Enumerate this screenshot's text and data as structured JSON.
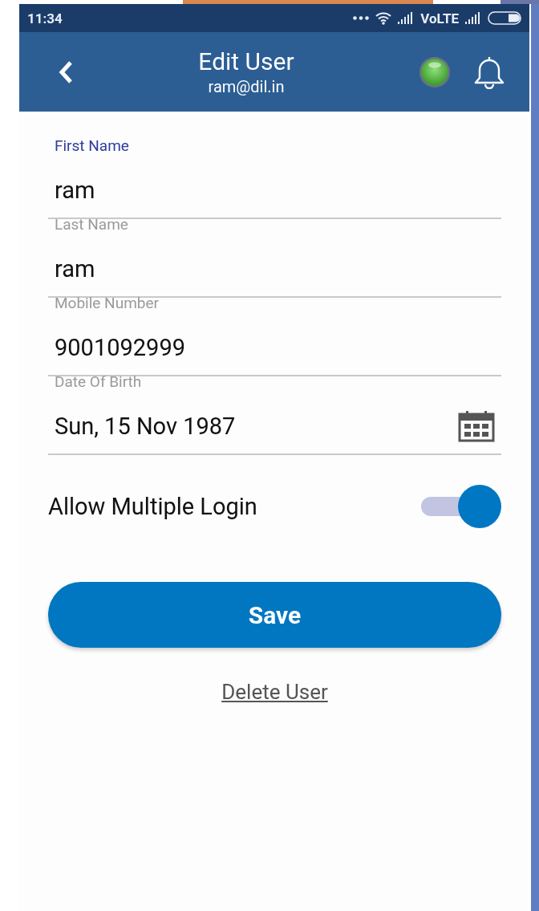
{
  "status_bar": {
    "time": "11:34",
    "network": "VoLTE"
  },
  "header": {
    "title": "Edit User",
    "subtitle": "ram@dil.in",
    "connected": true
  },
  "fields": [
    {
      "label": "First Name",
      "value": "ram",
      "focused": true,
      "kind": "text"
    },
    {
      "label": "Last Name",
      "value": "ram",
      "focused": false,
      "kind": "text"
    },
    {
      "label": "Mobile Number",
      "value": "9001092999",
      "focused": false,
      "kind": "text"
    },
    {
      "label": "Date Of Birth",
      "value": "Sun, 15 Nov 1987",
      "focused": false,
      "kind": "date"
    }
  ],
  "allow_multiple_login": {
    "label": "Allow Multiple Login",
    "on": true
  },
  "save_button": "Save",
  "delete_link": "Delete User"
}
